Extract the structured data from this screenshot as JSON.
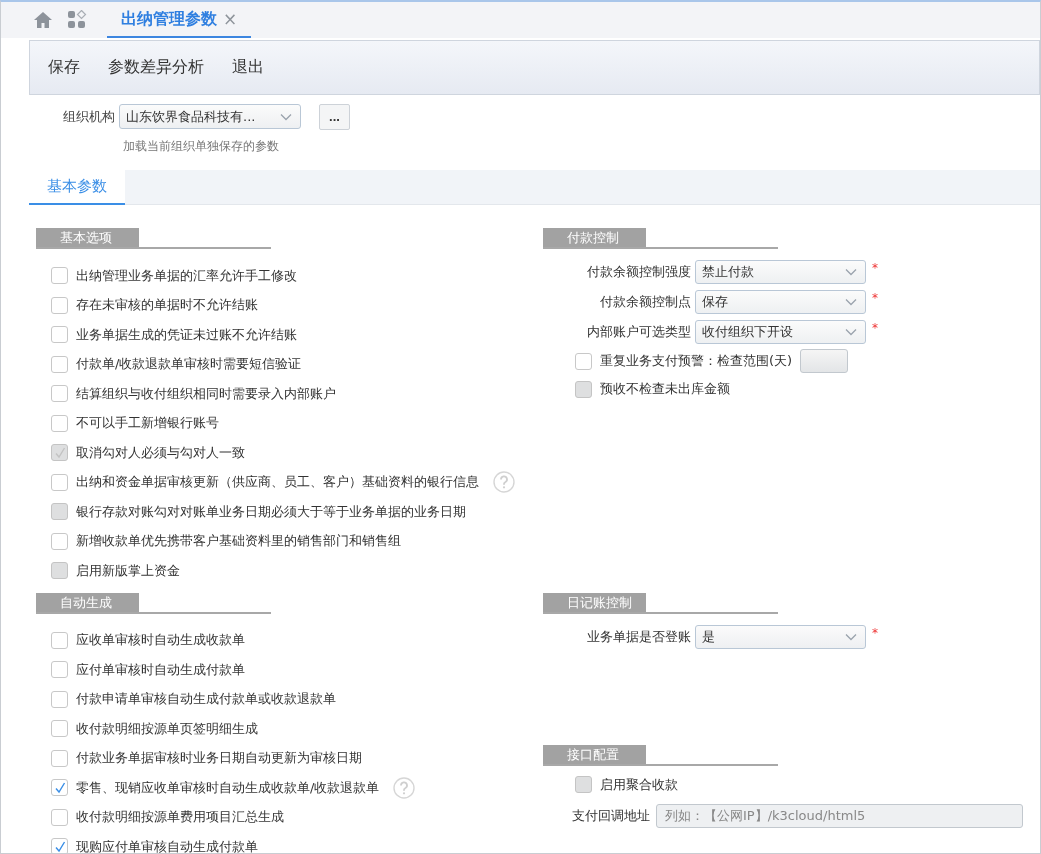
{
  "tabs": [
    {
      "label": "出纳管理参数",
      "selected": true,
      "close": "×"
    }
  ],
  "toolbar": [
    "保存",
    "参数差异分析",
    "退出"
  ],
  "organization": {
    "label": "组织机构",
    "value": "山东饮界食品科技有...",
    "more": "...",
    "hint": "加载当前组织单独保存的参数"
  },
  "page_tabs": [
    {
      "label": "基本参数",
      "selected": true
    }
  ],
  "left_sections": [
    {
      "title": "基本选项",
      "items": [
        {
          "kind": "checkbox",
          "label": "出纳管理业务单据的汇率允许手工修改",
          "checked": false,
          "disabled": false,
          "help": false
        },
        {
          "kind": "checkbox",
          "label": "存在未审核的单据时不允许结账",
          "checked": false,
          "disabled": false,
          "help": false
        },
        {
          "kind": "checkbox",
          "label": "业务单据生成的凭证未过账不允许结账",
          "checked": false,
          "disabled": false,
          "help": false
        },
        {
          "kind": "checkbox",
          "label": "付款单/收款退款单审核时需要短信验证",
          "checked": false,
          "disabled": false,
          "help": false
        },
        {
          "kind": "checkbox",
          "label": "结算组织与收付组织相同时需要录入内部账户",
          "checked": false,
          "disabled": false,
          "help": false
        },
        {
          "kind": "checkbox",
          "label": "不可以手工新增银行账号",
          "checked": false,
          "disabled": false,
          "help": false
        },
        {
          "kind": "checkbox",
          "label": "取消勾对人必须与勾对人一致",
          "checked": true,
          "disabled": true,
          "help": false
        },
        {
          "kind": "checkbox",
          "label": "出纳和资金单据审核更新（供应商、员工、客户）基础资料的银行信息",
          "checked": false,
          "disabled": false,
          "help": true
        },
        {
          "kind": "checkbox",
          "label": "银行存款对账勾对对账单业务日期必须大于等于业务单据的业务日期",
          "checked": false,
          "disabled": true,
          "help": false
        },
        {
          "kind": "checkbox",
          "label": "新增收款单优先携带客户基础资料里的销售部门和销售组",
          "checked": false,
          "disabled": false,
          "help": false
        },
        {
          "kind": "checkbox",
          "label": "启用新版掌上资金",
          "checked": false,
          "disabled": true,
          "help": false
        }
      ]
    },
    {
      "title": "自动生成",
      "items": [
        {
          "kind": "checkbox",
          "label": "应收单审核时自动生成收款单",
          "checked": false,
          "disabled": false,
          "help": false
        },
        {
          "kind": "checkbox",
          "label": "应付单审核时自动生成付款单",
          "checked": false,
          "disabled": false,
          "help": false
        },
        {
          "kind": "checkbox",
          "label": "付款申请单审核自动生成付款单或收款退款单",
          "checked": false,
          "disabled": false,
          "help": false
        },
        {
          "kind": "checkbox",
          "label": "收付款明细按源单页签明细生成",
          "checked": false,
          "disabled": false,
          "help": false
        },
        {
          "kind": "checkbox",
          "label": "付款业务单据审核时业务日期自动更新为审核日期",
          "checked": false,
          "disabled": false,
          "help": false
        },
        {
          "kind": "checkbox",
          "label": "零售、现销应收单审核时自动生成收款单/收款退款单",
          "checked": true,
          "disabled": false,
          "help": true
        },
        {
          "kind": "checkbox",
          "label": "收付款明细按源单费用项目汇总生成",
          "checked": false,
          "disabled": false,
          "help": false
        },
        {
          "kind": "checkbox",
          "label": "现购应付单审核自动生成付款单",
          "checked": true,
          "disabled": false,
          "help": false
        }
      ]
    }
  ],
  "right_sections": [
    {
      "title": "付款控制",
      "items": [
        {
          "kind": "select",
          "label": "付款余额控制强度",
          "value": "禁止付款",
          "required_mark": "*"
        },
        {
          "kind": "select",
          "label": "付款余额控制点",
          "value": "保存",
          "required_mark": "*"
        },
        {
          "kind": "select",
          "label": "内部账户可选类型",
          "value": "收付组织下开设",
          "required_mark": "*"
        },
        {
          "kind": "checkbox_input",
          "label": "重复业务支付预警：检查范围(天)",
          "checked": false,
          "disabled": false
        },
        {
          "kind": "checkbox",
          "label": "预收不检查未出库金额",
          "checked": false,
          "disabled": true,
          "help": false
        }
      ]
    },
    {
      "title": "日记账控制",
      "items": [
        {
          "kind": "select",
          "label": "业务单据是否登账",
          "value": "是",
          "required_mark": "*"
        }
      ]
    },
    {
      "title": "接口配置",
      "items": [
        {
          "kind": "checkbox",
          "label": "启用聚合收款",
          "checked": false,
          "disabled": true,
          "help": false
        },
        {
          "kind": "text",
          "label": "支付回调地址",
          "placeholder": "列如：【公网IP】/k3cloud/html5"
        }
      ]
    }
  ]
}
